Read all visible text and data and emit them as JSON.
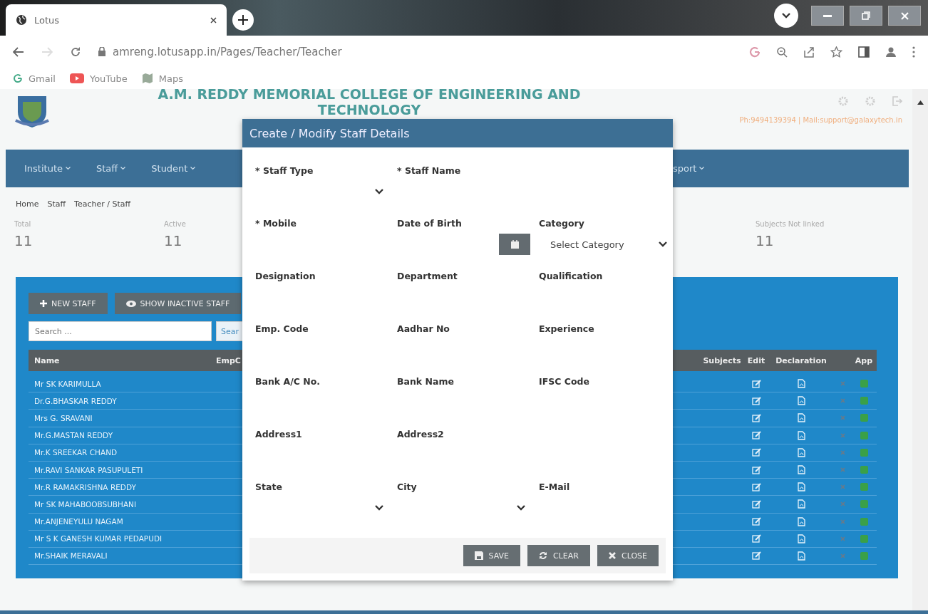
{
  "browser": {
    "tab": {
      "title": "Lotus",
      "selected": true
    },
    "url": "amreng.lotusapp.in/Pages/Teacher/Teacher",
    "bookmarks": [
      {
        "label": "Gmail",
        "kind": "google"
      },
      {
        "label": "YouTube",
        "kind": "youtube"
      },
      {
        "label": "Maps",
        "kind": "maps"
      }
    ]
  },
  "header": {
    "college_name": "A.M. REDDY MEMORIAL COLLEGE OF ENGINEERING AND",
    "college_name_line2": "TECHNOLOGY",
    "contact": "Ph:9494139394 | Mail:support@galaxytech.in"
  },
  "nav": {
    "items": [
      "Institute",
      "Staff",
      "Student"
    ],
    "item_cut": "sport"
  },
  "breadcrumb": [
    "Home",
    "Staff",
    "Teacher / Staff"
  ],
  "stats": [
    {
      "label": "Total",
      "value": "11"
    },
    {
      "label": "Active",
      "value": "11"
    },
    {
      "label": "Subjects Not linked",
      "value": "11"
    }
  ],
  "toolbar": {
    "buttons": [
      {
        "label": "NEW STAFF",
        "kind": "add"
      },
      {
        "label": "SHOW INACTIVE STAFF",
        "kind": "view"
      }
    ],
    "search": {
      "placeholder": "Search ..."
    },
    "search_button": "Sear"
  },
  "table": {
    "columns_left": [
      "Name",
      "EmpC"
    ],
    "columns_right": [
      "Subjects",
      "Edit",
      "Declaration",
      "App"
    ],
    "rows": [
      {
        "name": "Mr SK KARIMULLA"
      },
      {
        "name": "Dr.G.BHASKAR REDDY"
      },
      {
        "name": "Mrs G. SRAVANI"
      },
      {
        "name": "Mr.G.MASTAN REDDY"
      },
      {
        "name": "Mr.K SREEKAR CHAND"
      },
      {
        "name": "Mr.RAVI SANKAR PASUPULETI"
      },
      {
        "name": "Mr.R RAMAKRISHNA REDDY"
      },
      {
        "name": "Mr SK MAHABOOBSUBHANI"
      },
      {
        "name": "Mr.ANJENEYULU NAGAM"
      },
      {
        "name": "Mr S K GANESH KUMAR PEDAPUDI"
      },
      {
        "name": "Mr.SHAIK MERAVALI"
      }
    ]
  },
  "modal": {
    "title": "Create / Modify Staff Details",
    "rows": [
      [
        {
          "label": "* Staff Type",
          "kind": "select"
        },
        {
          "label": "* Staff Name",
          "kind": "input"
        }
      ],
      [
        {
          "label": "* Mobile",
          "kind": "input"
        },
        {
          "label": "Date of Birth",
          "kind": "date"
        },
        {
          "label": "Category",
          "kind": "select",
          "value": "Select Category"
        }
      ],
      [
        {
          "label": "Designation",
          "kind": "input"
        },
        {
          "label": "Department",
          "kind": "input"
        },
        {
          "label": "Qualification",
          "kind": "input"
        }
      ],
      [
        {
          "label": "Emp. Code",
          "kind": "input"
        },
        {
          "label": "Aadhar No",
          "kind": "input"
        },
        {
          "label": "Experience",
          "kind": "input"
        }
      ],
      [
        {
          "label": "Bank A/C No.",
          "kind": "input"
        },
        {
          "label": "Bank Name",
          "kind": "input"
        },
        {
          "label": "IFSC Code",
          "kind": "input"
        }
      ],
      [
        {
          "label": "Address1",
          "kind": "input"
        },
        {
          "label": "Address2",
          "kind": "input"
        }
      ],
      [
        {
          "label": "State",
          "kind": "select"
        },
        {
          "label": "City",
          "kind": "select"
        },
        {
          "label": "E-Mail",
          "kind": "input"
        }
      ]
    ],
    "buttons": [
      {
        "label": "SAVE",
        "kind": "save"
      },
      {
        "label": "CLEAR",
        "kind": "clear"
      },
      {
        "label": "CLOSE",
        "kind": "close"
      }
    ]
  }
}
